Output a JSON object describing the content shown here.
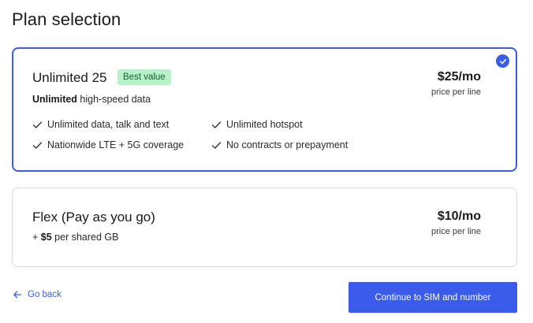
{
  "page": {
    "title": "Plan selection"
  },
  "plans": [
    {
      "name": "Unlimited 25",
      "badge": "Best value",
      "desc_bold": "Unlimited",
      "desc_rest": " high-speed data",
      "price": "$25/mo",
      "price_sub": "price per line",
      "selected": true,
      "features": [
        "Unlimited data, talk and text",
        "Unlimited hotspot",
        "Nationwide LTE + 5G coverage",
        "No contracts or prepayment"
      ]
    },
    {
      "name": "Flex (Pay as you go)",
      "desc_pre": "+ ",
      "desc_bold": "$5",
      "desc_rest": " per shared GB",
      "price": "$10/mo",
      "price_sub": "price per line",
      "selected": false
    }
  ],
  "footer": {
    "back_label": "Go back",
    "continue_label": "Continue to SIM and number"
  },
  "colors": {
    "accent": "#3b5bea",
    "badge_bg": "#b8f0c8",
    "badge_text": "#14632f",
    "border": "#d8d8dc"
  },
  "icons": {
    "selected": "checkmark-circle-icon",
    "feature": "check-icon",
    "back": "arrow-left-icon"
  }
}
